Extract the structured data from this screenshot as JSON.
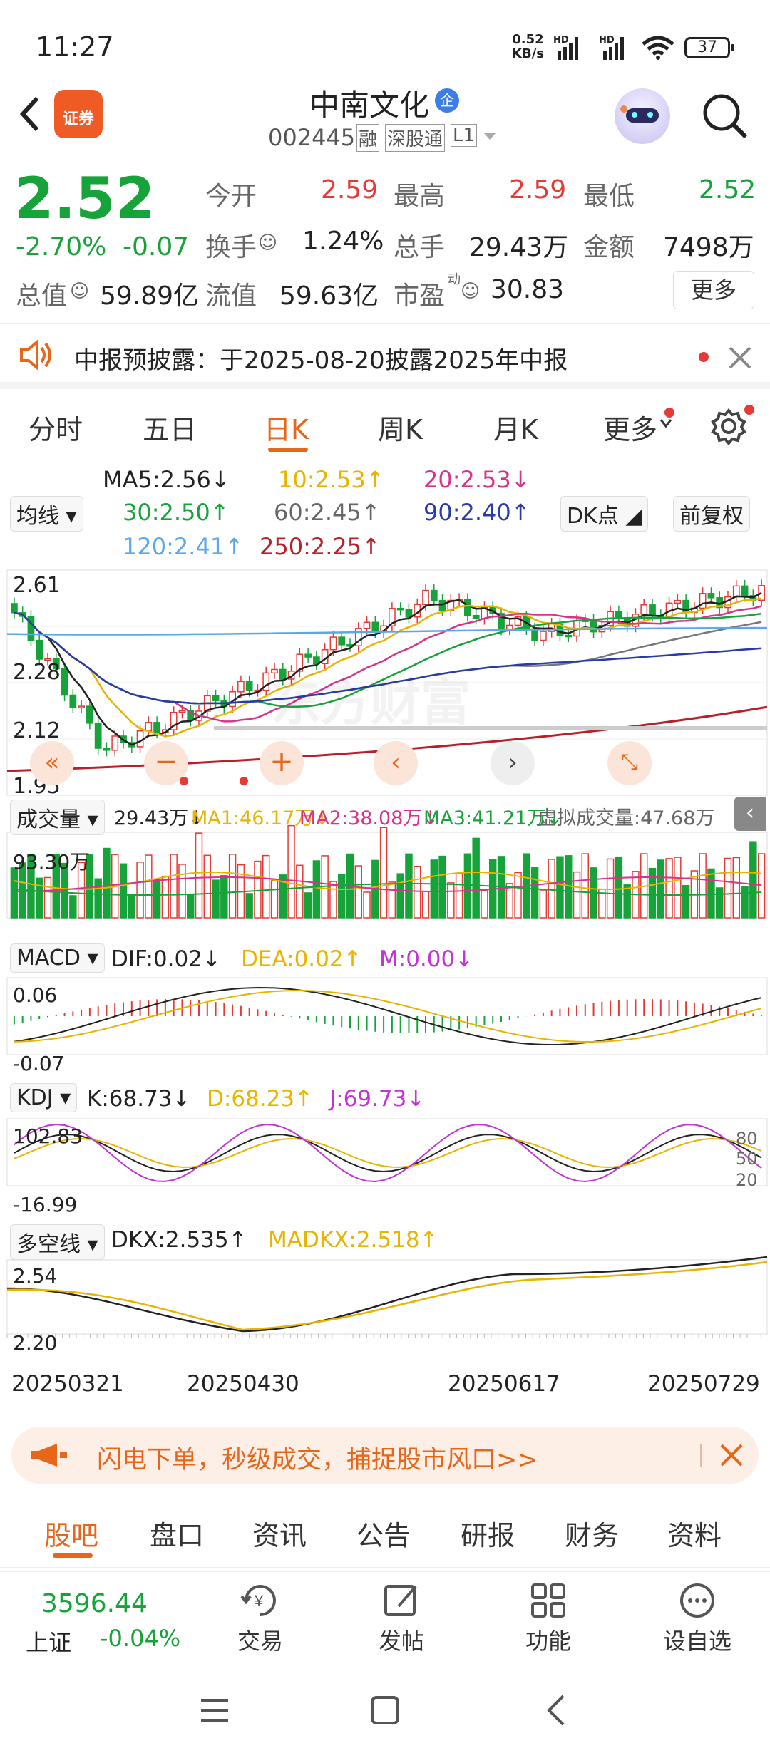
{
  "status": {
    "time": "11:27",
    "speed": "0.52",
    "speed_unit": "KB/s",
    "hd1": "HD",
    "hd2": "HD",
    "battery": "37"
  },
  "header": {
    "back_icon": "chevron-left-icon",
    "logo_text": "证券",
    "name": "中南文化",
    "badge": "企",
    "code": "002445",
    "tag1": "融",
    "tag2": "深股通",
    "tag3": "L1"
  },
  "quote": {
    "price": "2.52",
    "change_pct": "-2.70%",
    "change": "-0.07",
    "open_label": "今开",
    "open": "2.59",
    "high_label": "最高",
    "high": "2.59",
    "low_label": "最低",
    "low": "2.52",
    "turnover_label": "换手",
    "turnover": "1.24%",
    "volume_label": "总手",
    "volume": "29.43万",
    "amount_label": "金额",
    "amount": "7498万",
    "mktcap_label": "总值",
    "mktcap": "59.89亿",
    "float_label": "流值",
    "float": "59.63亿",
    "pe_label": "市盈",
    "pe_sup": "动",
    "pe": "30.83",
    "more": "更多"
  },
  "notice": {
    "text": "中报预披露：于2025-08-20披露2025年中报"
  },
  "tabs": [
    "分时",
    "五日",
    "日K",
    "周K",
    "月K",
    "更多"
  ],
  "ma": {
    "selector": "均线",
    "ma5": "MA5:2.56↓",
    "ma10": "10:2.53↑",
    "ma20": "20:2.53↓",
    "ma30": "30:2.50↑",
    "ma60": "60:2.45↑",
    "ma90": "90:2.40↑",
    "ma120": "120:2.41↑",
    "ma250": "250:2.25↑",
    "dk": "DK点",
    "fq": "前复权"
  },
  "kline": {
    "y_top": "2.61",
    "y_mid": "2.28",
    "y_low": "2.12",
    "y_min": "1.95",
    "watermark": "东方财富"
  },
  "vol": {
    "selector": "成交量",
    "val": "29.43万↓",
    "ma1": "MA1:46.17万↓",
    "ma2": "MA2:38.08万↓",
    "ma3": "MA3:41.21万↓",
    "virtual": "虚拟成交量:47.68万",
    "ytop": "93.30万"
  },
  "macd": {
    "selector": "MACD",
    "dif": "DIF:0.02↓",
    "dea": "DEA:0.02↑",
    "m": "M:0.00↓",
    "ytop": "0.06",
    "ybot": "-0.07"
  },
  "kdj": {
    "selector": "KDJ",
    "k": "K:68.73↓",
    "d": "D:68.23↑",
    "j": "J:69.73↓",
    "ytop": "102.83",
    "ybot": "-16.99",
    "r80": "80",
    "r50": "50",
    "r20": "20"
  },
  "dkx": {
    "selector": "多空线",
    "dkx": "DKX:2.535↑",
    "madkx": "MADKX:2.518↑",
    "ytop": "2.54",
    "ybot": "2.20"
  },
  "dates": [
    "20250321",
    "20250430",
    "20250617",
    "20250729"
  ],
  "promo": {
    "text": "闪电下单，秒级成交，捕捉股市风口>>"
  },
  "bottom_tabs": [
    "股吧",
    "盘口",
    "资讯",
    "公告",
    "研报",
    "财务",
    "资料"
  ],
  "dock": {
    "index_value": "3596.44",
    "index_name": "上证",
    "index_change": "-0.04%",
    "trade": "交易",
    "post": "发帖",
    "func": "功能",
    "watch": "设自选"
  },
  "colors": {
    "up": "#e63a36",
    "down": "#16a33a",
    "accent": "#e8661a",
    "ma5": "#222222",
    "ma10": "#e8b400",
    "ma20": "#d6338a",
    "ma30": "#16a33a",
    "ma60": "#777777",
    "ma90": "#2a3aa6",
    "ma120": "#5aa8ea",
    "ma250": "#b8202a"
  }
}
